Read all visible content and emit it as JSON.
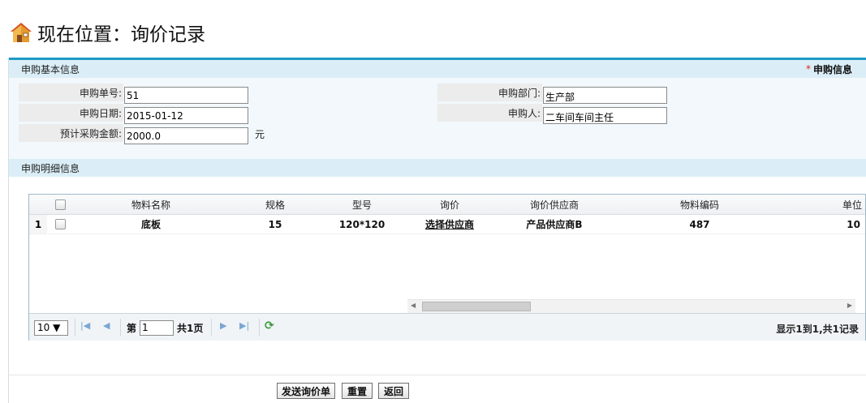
{
  "header": {
    "title": "现在位置：询价记录",
    "icon": "house-icon"
  },
  "sections": {
    "basic": "申购基本信息",
    "basic_right": "申购信息",
    "detail": "申购明细信息"
  },
  "form": {
    "order_no": {
      "label": "申购单号:",
      "value": "51"
    },
    "date": {
      "label": "申购日期:",
      "value": "2015-01-12"
    },
    "amount": {
      "label": "预计采购金额:",
      "value": "2000.0",
      "unit": "元"
    },
    "dept": {
      "label": "申购部门:",
      "value": "生产部"
    },
    "person": {
      "label": "申购人:",
      "value": "二车间车间主任"
    }
  },
  "grid": {
    "columns": [
      "物料名称",
      "规格",
      "型号",
      "询价",
      "询价供应商",
      "物料编码",
      "单位"
    ],
    "rows": [
      {
        "num": "1",
        "material": "底板",
        "spec": "15",
        "model": "120*120",
        "inquiry": "选择供应商",
        "supplier": "产品供应商B",
        "code": "487",
        "unit": "10"
      }
    ]
  },
  "pager": {
    "page_size": "10 ▼",
    "page_prefix": "第",
    "page_value": "1",
    "page_total": "共1页",
    "info": "显示1到1,共1记录"
  },
  "buttons": {
    "send": "发送询价单",
    "reset": "重置",
    "back": "返回"
  },
  "colors": {
    "accent": "#1d9bc4",
    "section_bg": "#dbeef7",
    "required": "#dd2222"
  }
}
